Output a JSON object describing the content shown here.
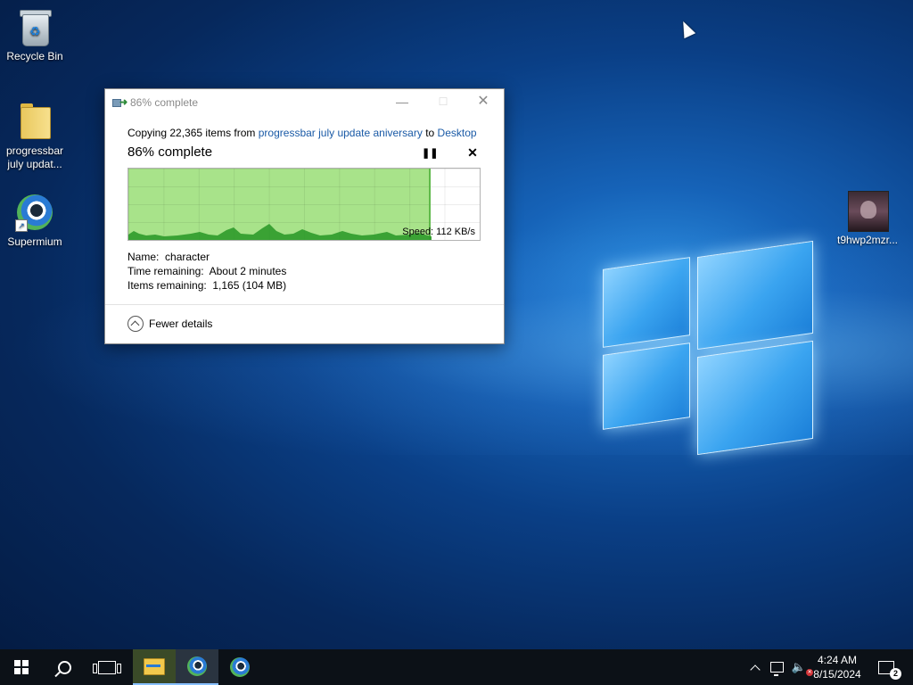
{
  "desktop": {
    "icons": [
      {
        "label": "Recycle Bin",
        "icon": "recycle-bin-icon"
      },
      {
        "label": "progressbar july updat...",
        "icon": "folder-icon"
      },
      {
        "label": "Supermium",
        "icon": "browser-icon"
      },
      {
        "label": "t9hwp2mzr...",
        "icon": "image-file-icon"
      }
    ]
  },
  "dialog": {
    "title": "86% complete",
    "window_buttons": {
      "minimize": "—",
      "maximize": "☐",
      "close": "✕"
    },
    "copy_prefix": "Copying 22,365 items from ",
    "source": "progressbar july update aniversary",
    "to": " to ",
    "destination": "Desktop",
    "percent_text": "86% complete",
    "pause_glyph": "❚❚",
    "stop_glyph": "✕",
    "progress": 0.86,
    "speed": "Speed: 112 KB/s",
    "fill_color": "#a8e38a",
    "line_color": "#2e9a2a",
    "details": {
      "name_label": "Name:",
      "name_value": "character",
      "time_label": "Time remaining:",
      "time_value": "About 2 minutes",
      "items_label": "Items remaining:",
      "items_value": "1,165 (104 MB)"
    },
    "fewer_details": "Fewer details"
  },
  "taskbar": {
    "clock_time": "4:24 AM",
    "clock_date": "8/15/2024",
    "notification_count": "2",
    "pinned": [
      "start-icon",
      "search-icon",
      "task-view-icon",
      "file-explorer-icon",
      "supermium-icon",
      "supermium-icon"
    ]
  }
}
